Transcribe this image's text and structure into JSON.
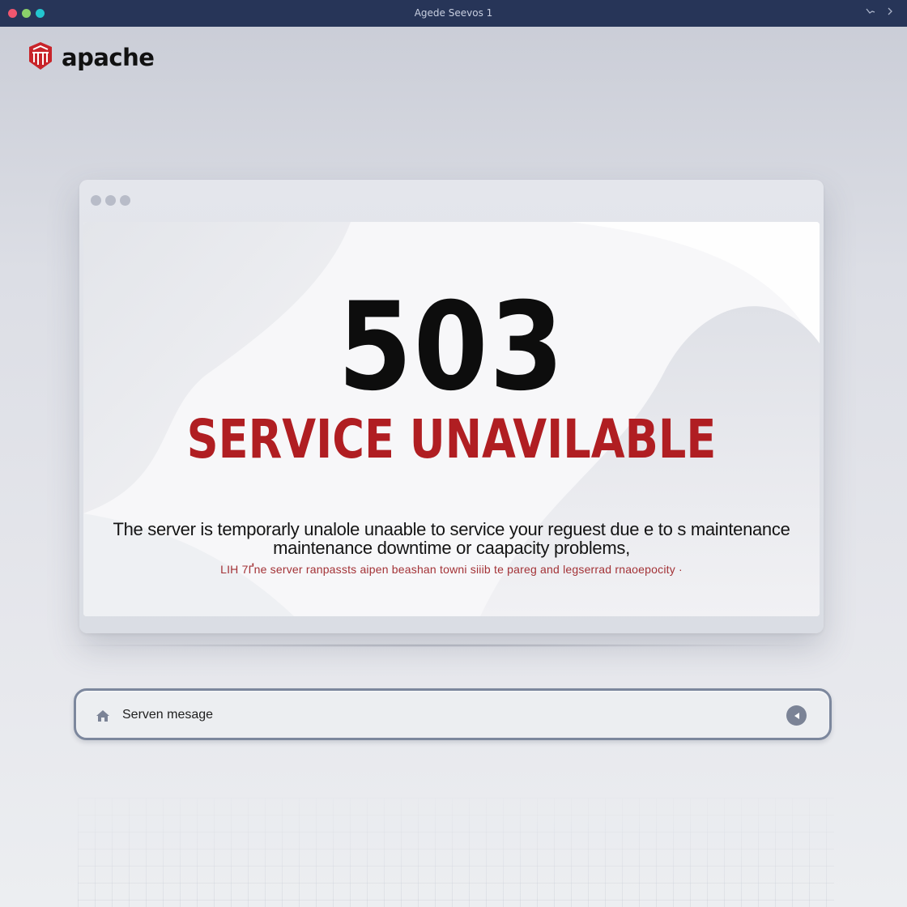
{
  "titlebar": {
    "title": "Agede Seevos 1",
    "controls": [
      "minimize-icon",
      "chevron-right-icon"
    ],
    "traffic_colors": [
      "#f0566f",
      "#8bd06a",
      "#23c6cf"
    ]
  },
  "logo": {
    "word": "apache",
    "icon": "apache-feather-icon",
    "color": "#c8242a"
  },
  "error": {
    "code": "503",
    "headline": "SERVICE UNAVILABLE",
    "message_line1": "The server is temporarly unalole unaable to service your reguest due e to s maintenance",
    "message_line2": "maintenance downtime or caapacity problems,",
    "submessage": "LIH 7Ґ́ne server ranpassts aipen beashan towni siiib te pareg and legserrad rnaoepocity ·"
  },
  "searchbar": {
    "text": "Serven mesage",
    "home_icon": "home-icon",
    "button_icon": "back-arrow-icon"
  },
  "colors": {
    "accent": "#b01e22",
    "titlebar": "#273558"
  }
}
